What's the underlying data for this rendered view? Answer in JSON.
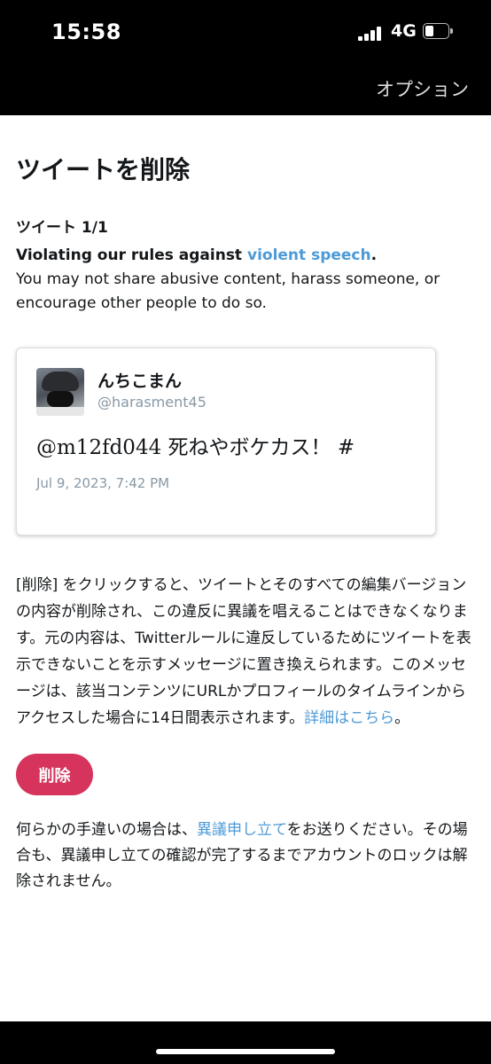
{
  "status_bar": {
    "time": "15:58",
    "network": "4G",
    "signal_icon": "cellular-signal-icon",
    "battery_icon": "battery-icon"
  },
  "nav": {
    "options_label": "オプション"
  },
  "page": {
    "title": "ツイートを削除",
    "counter": "ツイート 1/1",
    "violation_prefix": "Violating our rules against ",
    "violation_link": "violent speech",
    "violation_suffix": ".",
    "violation_description": "You may not share abusive content, harass someone, or encourage other people to do so."
  },
  "tweet": {
    "display_name": "んちこまん",
    "handle": "@harasment45",
    "text": "@m12fd044 死ねやボケカス！ #",
    "date": "Jul 9, 2023, 7:42 PM"
  },
  "explanation": {
    "text": "[削除] をクリックすると、ツイートとそのすべての編集バージョンの内容が削除され、この違反に異議を唱えることはできなくなります。元の内容は、Twitterルールに違反しているためにツイートを表示できないことを示すメッセージに置き換えられます。このメッセージは、該当コンテンツにURLかプロフィールのタイムラインからアクセスした場合に14日間表示されます。",
    "link": "詳細はこちら",
    "suffix": "。"
  },
  "actions": {
    "delete_label": "削除"
  },
  "appeal": {
    "prefix": "何らかの手違いの場合は、",
    "link": "異議申し立て",
    "suffix": "をお送りください。その場合も、異議申し立ての確認が完了するまでアカウントのロックは解除されません。"
  },
  "colors": {
    "link": "#4d9ad6",
    "delete_button": "#d6345d",
    "secondary_text": "#8899a6"
  }
}
